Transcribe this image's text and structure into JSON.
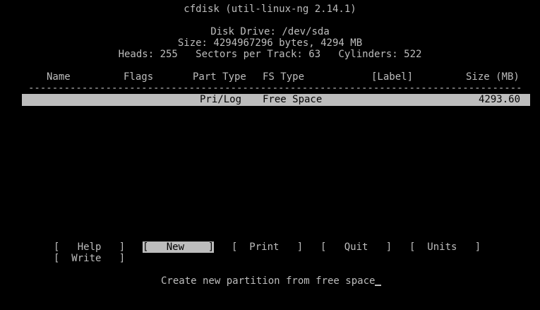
{
  "header": {
    "title": "cfdisk (util-linux-ng 2.14.1)",
    "disk_drive": "Disk Drive: /dev/sda",
    "size": "Size: 4294967296 bytes, 4294 MB",
    "geometry": "Heads: 255   Sectors per Track: 63   Cylinders: 522"
  },
  "table": {
    "columns": {
      "name": "Name",
      "flags": "Flags",
      "part_type": "Part Type",
      "fs_type": "FS Type",
      "label": "[Label]",
      "size": "Size (MB)"
    },
    "rule": "------------------------------------------------------------------------------------------------------",
    "rows": [
      {
        "name": "",
        "flags": "",
        "part_type": "Pri/Log",
        "fs_type": "Free Space",
        "label": "",
        "size": "4293.60",
        "selected": true
      }
    ]
  },
  "menu": {
    "help": "[   Help   ]",
    "new": "[   New    ]",
    "print": "[  Print   ]",
    "quit": "[   Quit   ]",
    "units": "[  Units   ]",
    "write": "[  Write   ]",
    "selected": "new"
  },
  "status": {
    "text": "Create new partition from free space"
  },
  "colors": {
    "background": "#000000",
    "foreground": "#bdbdbd",
    "highlight": "#bdbdbd"
  }
}
